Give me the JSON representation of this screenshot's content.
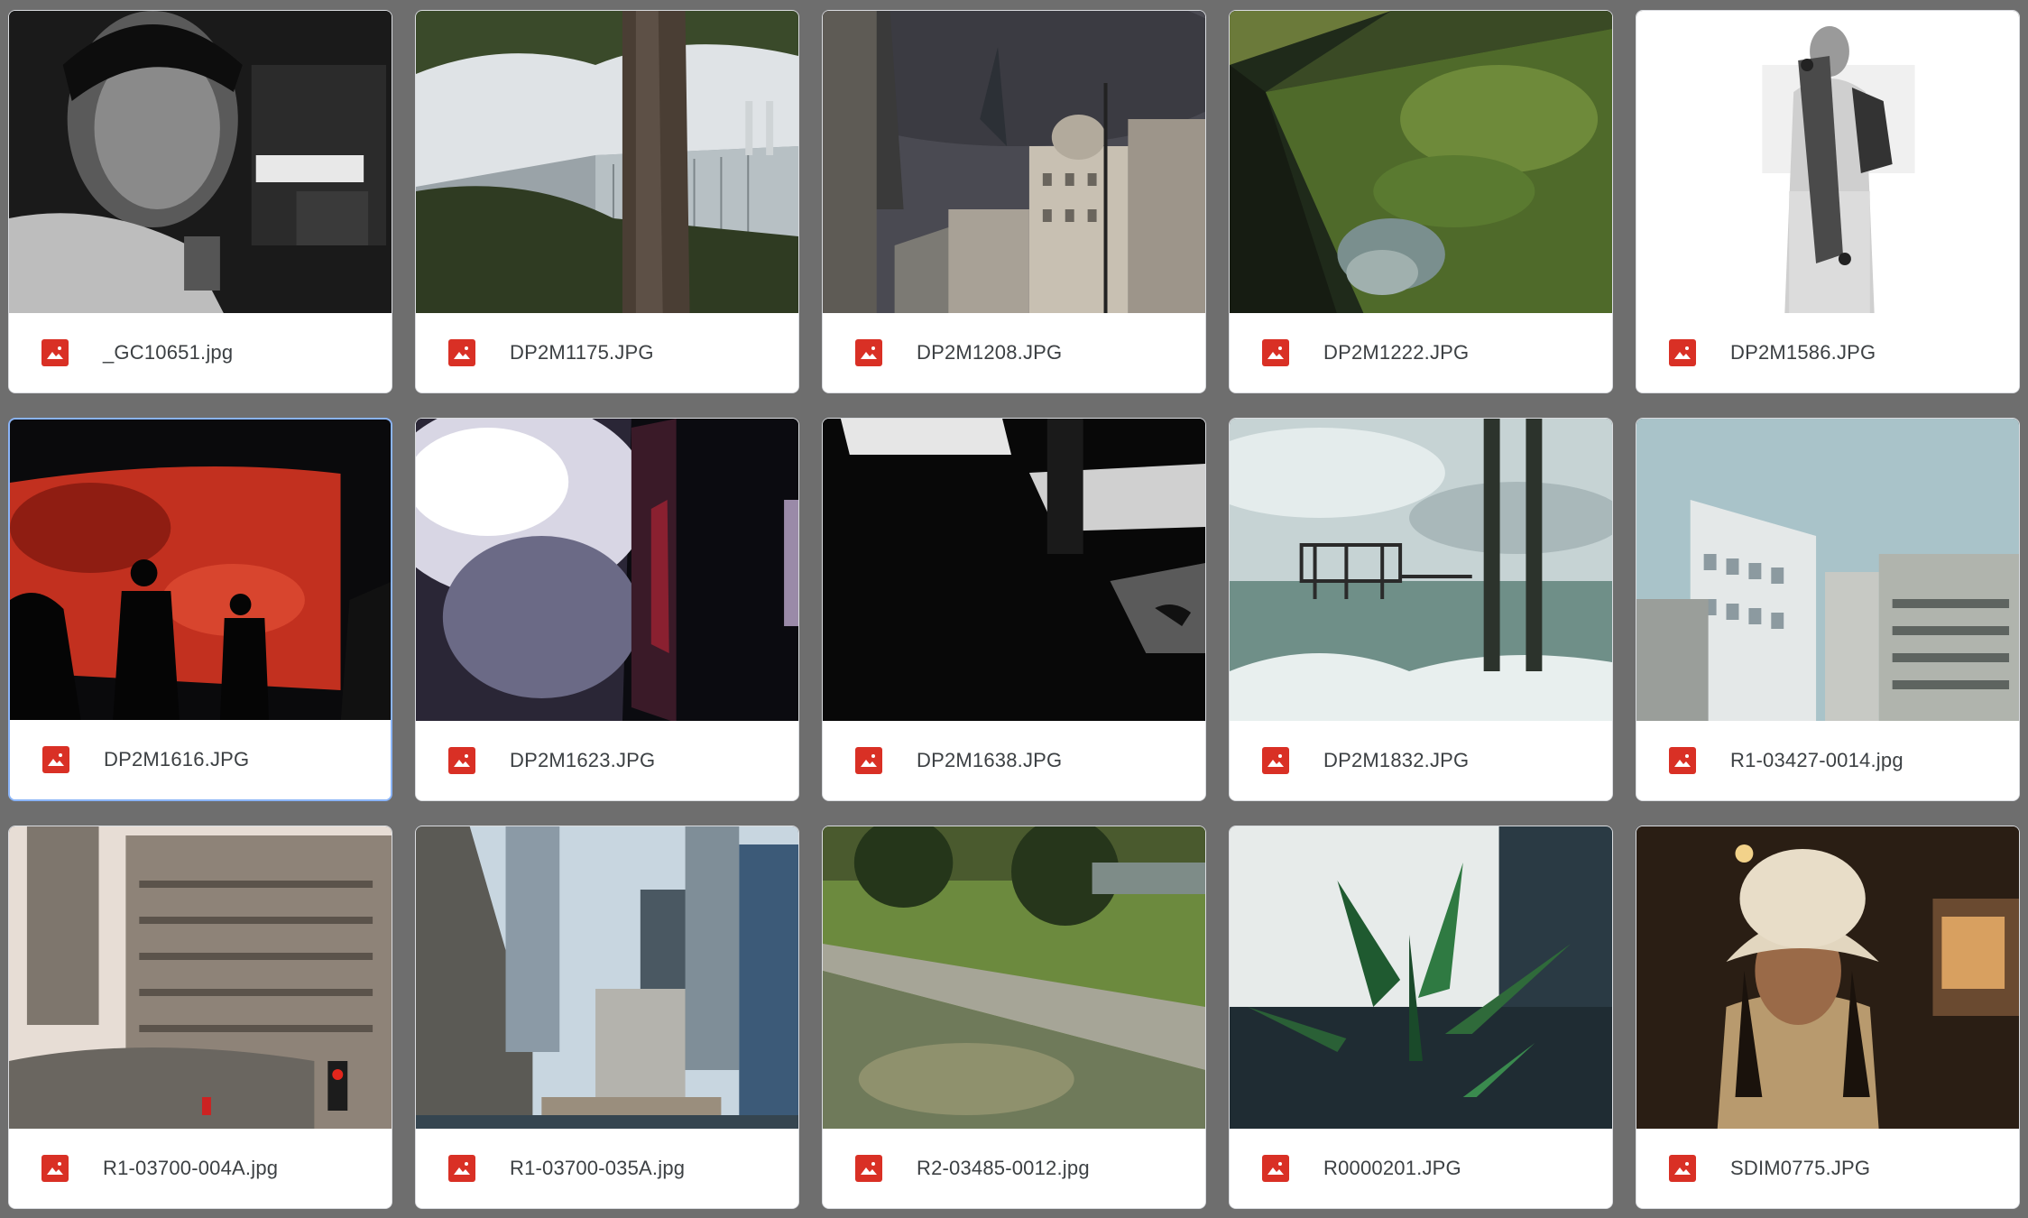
{
  "files": [
    {
      "name": "_GC10651.jpg",
      "thumb": "portrait-bw",
      "selected": false
    },
    {
      "name": "DP2M1175.JPG",
      "thumb": "tree-greenhouse",
      "selected": false
    },
    {
      "name": "DP2M1208.JPG",
      "thumb": "city-storm",
      "selected": false
    },
    {
      "name": "DP2M1222.JPG",
      "thumb": "pond-lilies",
      "selected": false
    },
    {
      "name": "DP2M1586.JPG",
      "thumb": "skateboard-person",
      "selected": false
    },
    {
      "name": "DP2M1616.JPG",
      "thumb": "red-planet-silhouettes",
      "selected": true
    },
    {
      "name": "DP2M1623.JPG",
      "thumb": "light-installation",
      "selected": false
    },
    {
      "name": "DP2M1638.JPG",
      "thumb": "dark-shadows",
      "selected": false
    },
    {
      "name": "DP2M1832.JPG",
      "thumb": "pier-sea",
      "selected": false
    },
    {
      "name": "R1-03427-0014.jpg",
      "thumb": "white-buildings",
      "selected": false
    },
    {
      "name": "R1-03700-004A.jpg",
      "thumb": "barbican-towers",
      "selected": false
    },
    {
      "name": "R1-03700-035A.jpg",
      "thumb": "canary-wharf",
      "selected": false
    },
    {
      "name": "R2-03485-0012.jpg",
      "thumb": "garden-pool",
      "selected": false
    },
    {
      "name": "R0000201.JPG",
      "thumb": "plant-leaves",
      "selected": false
    },
    {
      "name": "SDIM0775.JPG",
      "thumb": "woman-hat",
      "selected": false
    }
  ],
  "icon": "image-file-icon",
  "colors": {
    "icon": "#d93025",
    "background": "#6e6e6e",
    "selected_border": "#8ab4f8"
  }
}
